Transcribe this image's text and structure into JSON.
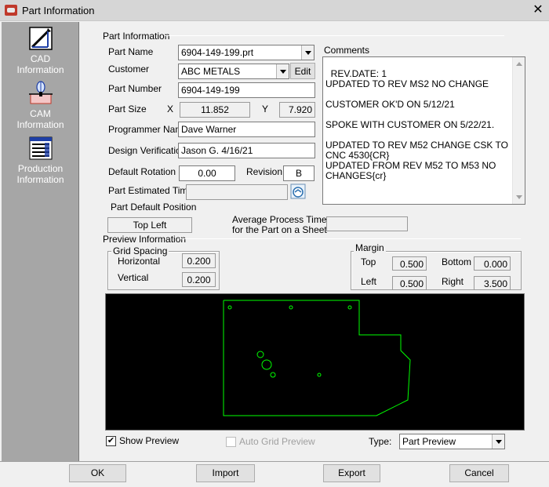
{
  "window": {
    "title": "Part Information"
  },
  "sidebar": {
    "items": [
      {
        "label": "CAD\nInformation",
        "icon": "cad-drawing-icon"
      },
      {
        "label": "CAM\nInformation",
        "icon": "cam-tool-icon"
      },
      {
        "label": "Production\nInformation",
        "icon": "production-list-icon"
      }
    ]
  },
  "part_info": {
    "section_label": "Part Information",
    "part_name_label": "Part Name",
    "part_name": "6904-149-199.prt",
    "customer_label": "Customer",
    "customer": "ABC METALS",
    "edit_label": "Edit",
    "part_number_label": "Part Number",
    "part_number": "6904-149-199",
    "part_size_label": "Part Size",
    "x_label": "X",
    "x_value": "11.852",
    "y_label": "Y",
    "y_value": "7.920",
    "programmer_label": "Programmer Name",
    "programmer": "Dave Warner",
    "design_verification_label": "Design Verification",
    "design_verification": "Jason G. 4/16/21",
    "default_rotation_label": "Default Rotation",
    "default_rotation": "0.00",
    "revision_label": "Revision",
    "revision": "B",
    "estimated_time_label": "Part Estimated Time",
    "estimated_time": "",
    "default_position_label": "Part Default Position",
    "default_position": "Top Left",
    "avg_process_label_1": "Average Process Time",
    "avg_process_label_2": "for the Part on a Sheet",
    "avg_process_value": ""
  },
  "comments": {
    "label": "Comments",
    "text": "REV.DATE: 1\nUPDATED TO REV MS2 NO CHANGE\n\nCUSTOMER OK'D ON 5/12/21\n\nSPOKE WITH CUSTOMER ON 5/22/21.\n\nUPDATED TO REV M52 CHANGE CSK TO CNC 4530{CR}\nUPDATED FROM REV M52 TO M53 NO CHANGES{cr}"
  },
  "preview_info": {
    "section_label": "Preview Information",
    "grid_spacing_label": "Grid Spacing",
    "horizontal_label": "Horizontal",
    "horizontal": "0.200",
    "vertical_label": "Vertical",
    "vertical": "0.200",
    "margin_label": "Margin",
    "top_label": "Top",
    "top": "0.500",
    "bottom_label": "Bottom",
    "bottom": "0.000",
    "left_label": "Left",
    "left": "0.500",
    "right_label": "Right",
    "right": "3.500",
    "show_preview_label": "Show Preview",
    "show_preview_checked": true,
    "auto_grid_label": "Auto Grid Preview",
    "auto_grid_checked": false,
    "type_label": "Type:",
    "type_value": "Part Preview",
    "outline_color": "#00ff00"
  },
  "buttons": {
    "ok": "OK",
    "import": "Import",
    "export": "Export",
    "cancel": "Cancel"
  }
}
